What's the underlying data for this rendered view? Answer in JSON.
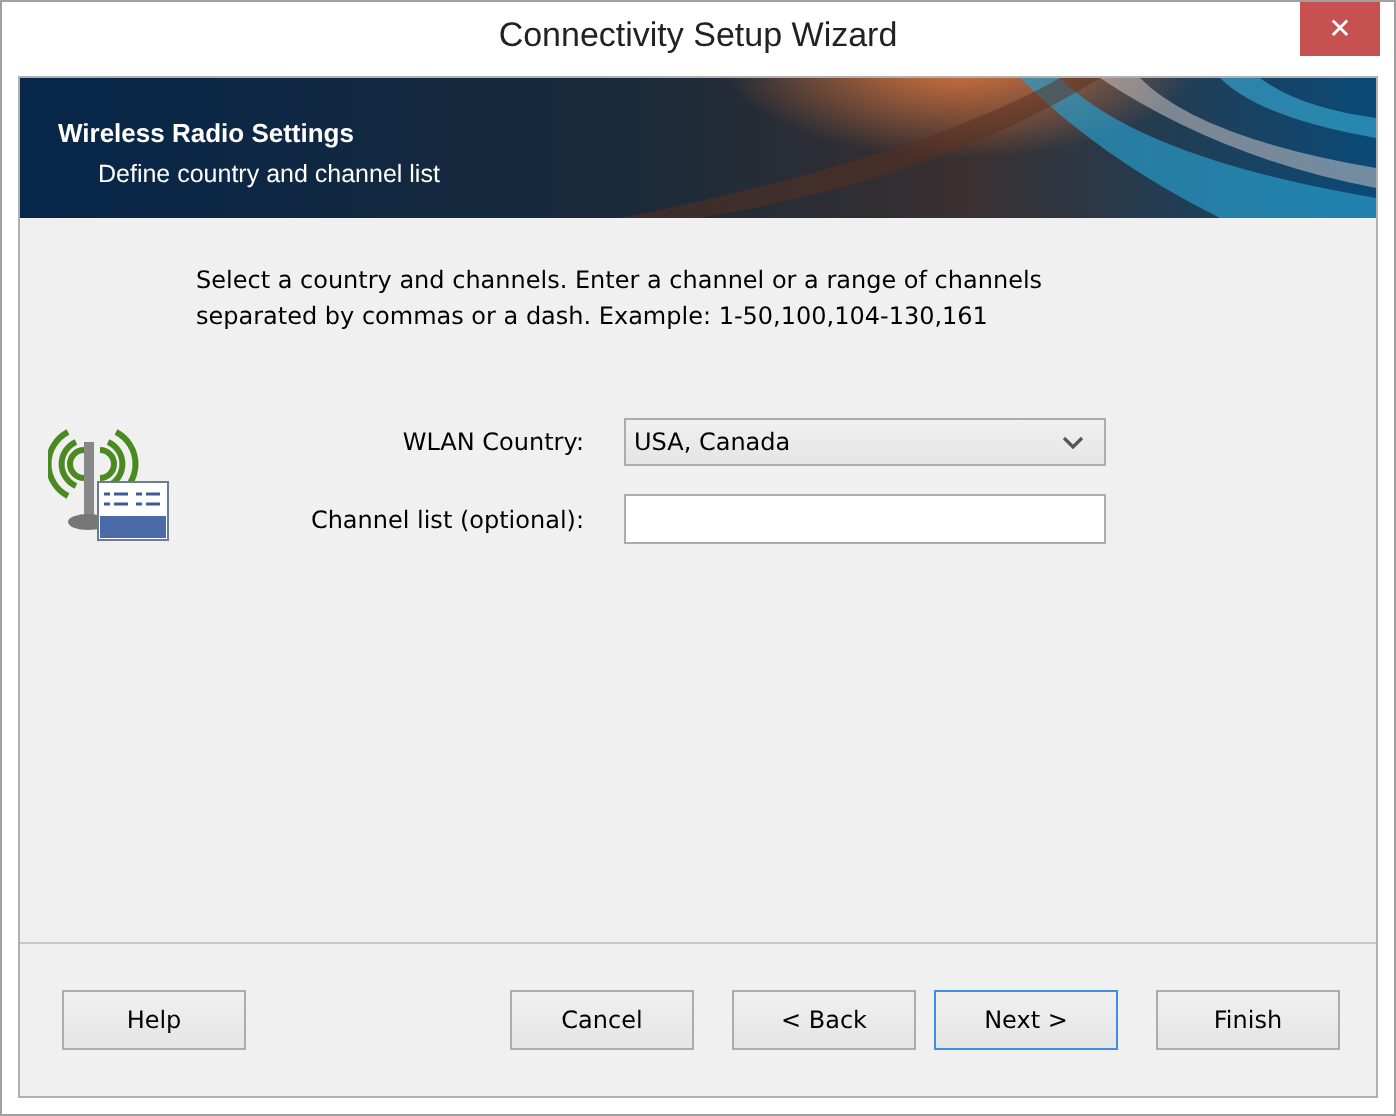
{
  "window": {
    "title": "Connectivity Setup Wizard",
    "close": "✕"
  },
  "header": {
    "title": "Wireless Radio Settings",
    "subtitle": "Define country and channel list"
  },
  "instructions": "Select a country and channels. Enter a channel or a range of channels separated by commas or a dash. Example: 1-50,100,104-130,161",
  "fields": [
    {
      "kind": "dropdown",
      "label": "WLAN Country:",
      "value": "USA, Canada"
    },
    {
      "kind": "text",
      "label": "Channel list (optional):"
    }
  ],
  "buttons": [
    {
      "label": "Help",
      "default": false
    },
    {
      "label": "Cancel",
      "default": false
    },
    {
      "label": "< Back",
      "default": false
    },
    {
      "label": "Next >",
      "default": true
    },
    {
      "label": "Finish",
      "default": false
    }
  ]
}
